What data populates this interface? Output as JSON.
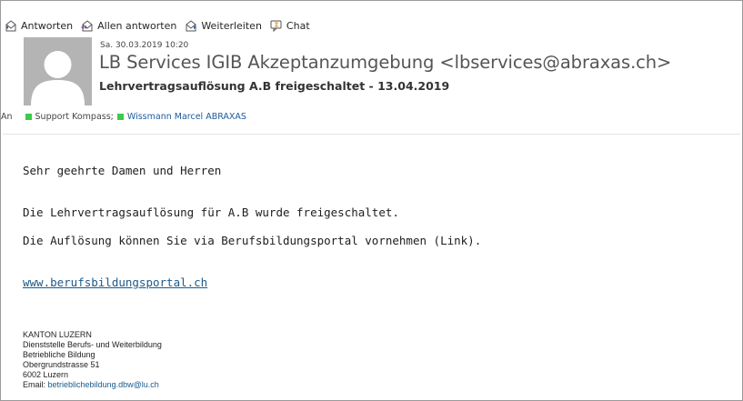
{
  "toolbar": {
    "reply": "Antworten",
    "reply_all": "Allen antworten",
    "forward": "Weiterleiten",
    "chat": "Chat"
  },
  "header": {
    "date": "Sa. 30.03.2019 10:20",
    "sender": "LB Services IGIB Akzeptanzumgebung <lbservices@abraxas.ch>",
    "subject": "Lehrvertragsauflösung A.B freigeschaltet - 13.04.2019",
    "to_label": "An",
    "recipients": [
      "Support Kompass;",
      "Wissmann Marcel ABRAXAS"
    ],
    "presence_color": "#3ccb4a"
  },
  "body": {
    "greeting": "Sehr geehrte Damen und Herren",
    "line1": "Die Lehrvertragsauflösung für A.B wurde freigeschaltet.",
    "line2": "Die Auflösung können Sie via Berufsbildungsportal vornehmen (Link).",
    "link": "www.berufsbildungsportal.ch"
  },
  "signature": {
    "org": "KANTON LUZERN",
    "dept": "Dienststelle Berufs- und Weiterbildung",
    "unit": "Betriebliche Bildung",
    "street": "Obergrundstrasse 51",
    "city": "6002 Luzern",
    "email_label": "Email: ",
    "email": "betrieblichebildung.dbw@lu.ch"
  }
}
